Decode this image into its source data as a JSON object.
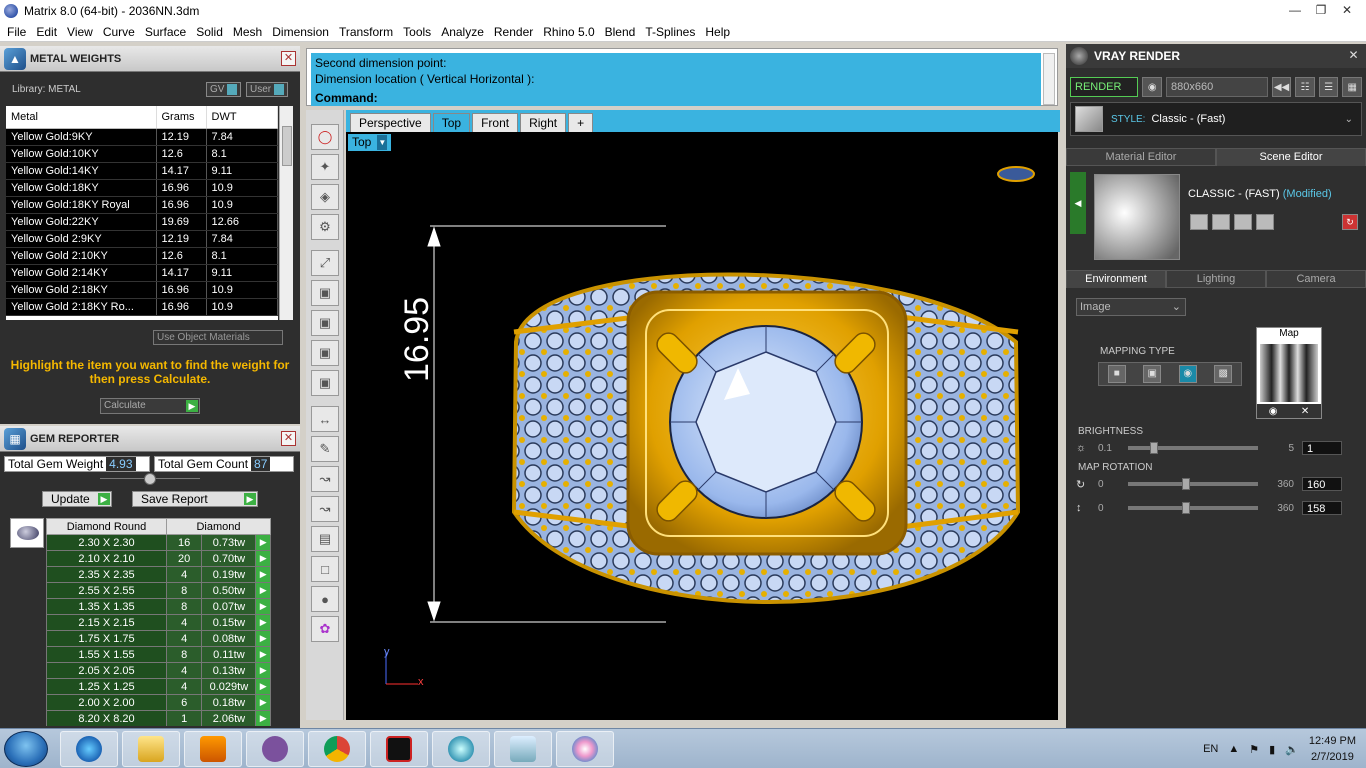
{
  "window": {
    "title": "Matrix 8.0 (64-bit) - 2036NN.3dm",
    "controls": [
      "minimize-icon",
      "restore-icon",
      "close-icon"
    ]
  },
  "menu": [
    "File",
    "Edit",
    "View",
    "Curve",
    "Surface",
    "Solid",
    "Mesh",
    "Dimension",
    "Transform",
    "Tools",
    "Analyze",
    "Render",
    "Rhino 5.0",
    "Blend",
    "T-Splines",
    "Help"
  ],
  "metal_weights": {
    "title": "METAL WEIGHTS",
    "library": "Library: METAL",
    "toggle_gv": "GV",
    "toggle_user": "User",
    "headers": [
      "Metal",
      "Grams",
      "DWT"
    ],
    "rows": [
      [
        "Yellow Gold:9KY",
        "12.19",
        "7.84"
      ],
      [
        "Yellow Gold:10KY",
        "12.6",
        "8.1"
      ],
      [
        "Yellow Gold:14KY",
        "14.17",
        "9.11"
      ],
      [
        "Yellow Gold:18KY",
        "16.96",
        "10.9"
      ],
      [
        "Yellow Gold:18KY Royal",
        "16.96",
        "10.9"
      ],
      [
        "Yellow Gold:22KY",
        "19.69",
        "12.66"
      ],
      [
        "Yellow Gold 2:9KY",
        "12.19",
        "7.84"
      ],
      [
        "Yellow Gold 2:10KY",
        "12.6",
        "8.1"
      ],
      [
        "Yellow Gold 2:14KY",
        "14.17",
        "9.11"
      ],
      [
        "Yellow Gold 2:18KY",
        "16.96",
        "10.9"
      ],
      [
        "Yellow Gold 2:18KY Ro...",
        "16.96",
        "10.9"
      ]
    ],
    "use_object_materials": "Use Object Materials",
    "instruction": "Highlight the item you want to find the weight for then press Calculate.",
    "calculate": "Calculate"
  },
  "gem_reporter": {
    "title": "GEM REPORTER",
    "total_weight_label": "Total Gem Weight",
    "total_weight": "4.93",
    "total_count_label": "Total Gem Count",
    "total_count": "87",
    "update": "Update",
    "save_report": "Save Report",
    "headers": [
      "Diamond Round",
      "Diamond"
    ],
    "rows": [
      [
        "2.30 X 2.30",
        "16",
        "0.73tw"
      ],
      [
        "2.10 X 2.10",
        "20",
        "0.70tw"
      ],
      [
        "2.35 X 2.35",
        "4",
        "0.19tw"
      ],
      [
        "2.55 X 2.55",
        "8",
        "0.50tw"
      ],
      [
        "1.35 X 1.35",
        "8",
        "0.07tw"
      ],
      [
        "2.15 X 2.15",
        "4",
        "0.15tw"
      ],
      [
        "1.75 X 1.75",
        "4",
        "0.08tw"
      ],
      [
        "1.55 X 1.55",
        "8",
        "0.11tw"
      ],
      [
        "2.05 X 2.05",
        "4",
        "0.13tw"
      ],
      [
        "1.25 X 1.25",
        "4",
        "0.029tw"
      ],
      [
        "2.00 X 2.00",
        "6",
        "0.18tw"
      ],
      [
        "8.20 X 8.20",
        "1",
        "2.06tw"
      ]
    ]
  },
  "command": {
    "history": [
      "Second dimension point:",
      "Dimension location ( Vertical  Horizontal ):"
    ],
    "prompt": "Command:",
    "value": ""
  },
  "viewport": {
    "tabs": [
      "Perspective",
      "Top",
      "Front",
      "Right"
    ],
    "add_tab": "+",
    "active_tab": "Top",
    "label": "Top",
    "dimension_text": "16.95",
    "axis_y": "y",
    "axis_x": "x"
  },
  "vray": {
    "title": "VRAY RENDER",
    "render": "RENDER",
    "resolution": "880x660",
    "style_label": "STYLE:",
    "style_value": "Classic - (Fast)",
    "editor_tabs": [
      "Material Editor",
      "Scene Editor"
    ],
    "scene_name": "CLASSIC - (FAST)",
    "scene_modified": "(Modified)",
    "env_tabs": [
      "Environment",
      "Lighting",
      "Camera"
    ],
    "env_type": "Image",
    "mapping_type": "MAPPING TYPE",
    "map_label": "Map",
    "brightness_label": "BRIGHTNESS",
    "brightness": {
      "min": "0.1",
      "max": "5",
      "value": "1",
      "level": 0.18
    },
    "map_rotation_label": "MAP ROTATION",
    "rotation_h": {
      "min": "0",
      "max": "360",
      "value": "160",
      "level": 0.44
    },
    "rotation_v": {
      "min": "0",
      "max": "360",
      "value": "158",
      "level": 0.44
    }
  },
  "taskbar": {
    "language": "EN",
    "time": "12:49 PM",
    "date": "2/7/2019",
    "apps": [
      "internet-explorer-icon",
      "file-explorer-icon",
      "media-player-icon",
      "viber-icon",
      "chrome-icon",
      "game-app-icon",
      "matrix-icon",
      "notepad-icon",
      "paint-icon"
    ]
  },
  "colors": {
    "accent_blue": "#3ab3e0",
    "gold": "#f0b000",
    "gem_blue": "#a8c4f0",
    "panel_dark": "#2e2e2e",
    "highlight_text": "#f5b800"
  }
}
